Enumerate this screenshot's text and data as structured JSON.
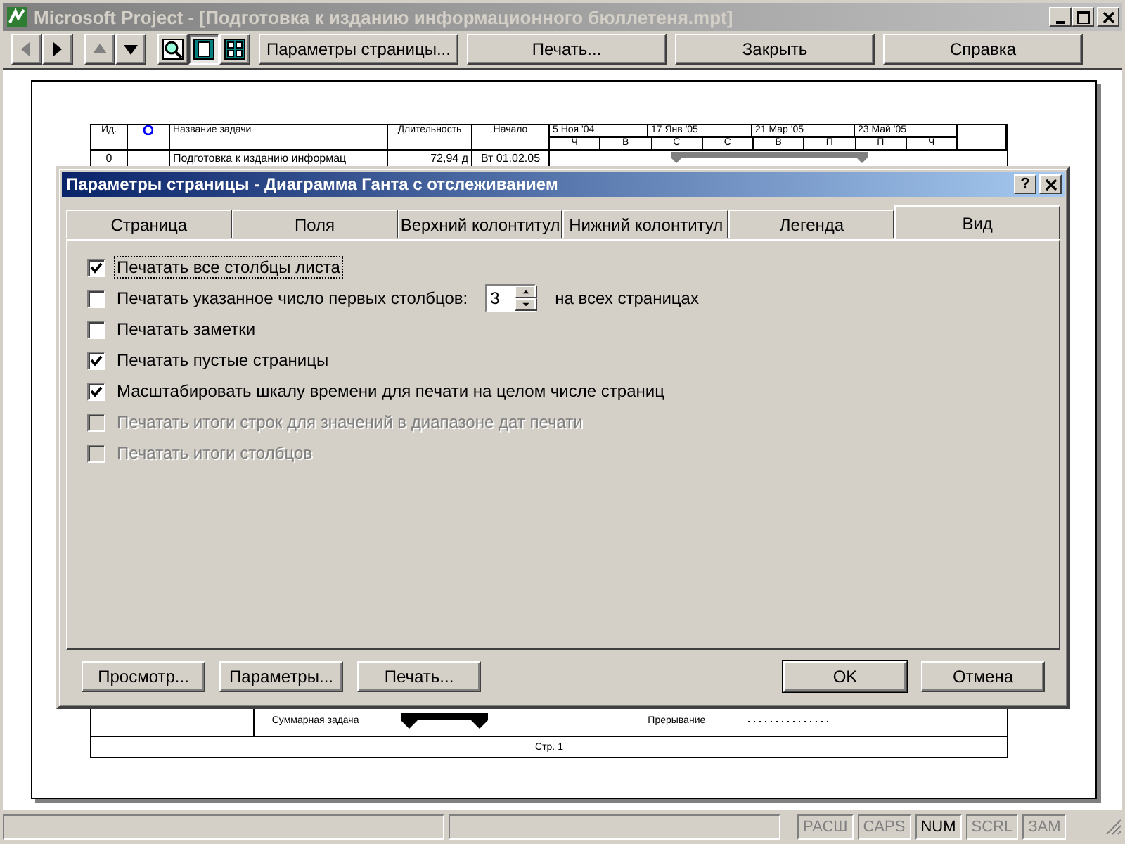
{
  "window": {
    "title": "Microsoft Project - [Подготовка к изданию информационного бюллетеня.mpt]"
  },
  "toolbar": {
    "nav_buttons": [
      {
        "kind": "left",
        "disabled": true
      },
      {
        "kind": "right",
        "disabled": false
      },
      {
        "kind": "up",
        "disabled": true
      },
      {
        "kind": "down",
        "disabled": false
      }
    ],
    "view_buttons": [
      {
        "kind": "zoom",
        "selected": false
      },
      {
        "kind": "one-page",
        "selected": true
      },
      {
        "kind": "multi-page",
        "selected": false
      }
    ],
    "buttons": [
      "Параметры страницы...",
      "Печать...",
      "Закрыть",
      "Справка"
    ]
  },
  "preview": {
    "table": {
      "columns": [
        "Ид.",
        "Название задачи",
        "Длительность",
        "Начало"
      ],
      "timescale": [
        {
          "label": "5 Ноя '04",
          "days": [
            "Ч",
            "В"
          ]
        },
        {
          "label": "17 Янв '05",
          "days": [
            "С",
            "С"
          ]
        },
        {
          "label": "21 Мар '05",
          "days": [
            "В",
            "П"
          ]
        },
        {
          "label": "23 Май '05",
          "days": [
            "П",
            "Ч"
          ]
        }
      ],
      "rows": [
        {
          "id": "0",
          "name": "Подготовка к изданию информац",
          "duration": "72,94 д",
          "start": "Вт 01.02.05"
        }
      ]
    },
    "legend": [
      {
        "kind": "summary",
        "label": "Суммарная задача"
      },
      {
        "kind": "split",
        "label": "Прерывание"
      }
    ],
    "footer": "Стр. 1"
  },
  "dialog": {
    "title": "Параметры страницы - Диаграмма Ганта с отслеживанием",
    "help_button": "?",
    "tabs": [
      {
        "label": "Страница",
        "selected": false
      },
      {
        "label": "Поля",
        "selected": false
      },
      {
        "label": "Верхний колонтитул",
        "selected": false
      },
      {
        "label": "Нижний колонтитул",
        "selected": false
      },
      {
        "label": "Легенда",
        "selected": false
      },
      {
        "label": "Вид",
        "selected": true
      }
    ],
    "options": [
      {
        "kind": "check",
        "label": "Печатать все столбцы листа",
        "checked": true,
        "disabled": false,
        "focused": true
      },
      {
        "kind": "spin",
        "label": "Печатать указанное число первых столбцов:",
        "value": "3",
        "suffix": "на всех страницах",
        "checked": false,
        "disabled": false,
        "focused": false
      },
      {
        "kind": "check",
        "label": "Печатать заметки",
        "checked": false,
        "disabled": false,
        "focused": false
      },
      {
        "kind": "check",
        "label": "Печатать пустые страницы",
        "checked": true,
        "disabled": false,
        "focused": false
      },
      {
        "kind": "check",
        "label": "Масштабировать шкалу времени для печати на целом числе страниц",
        "checked": true,
        "disabled": false,
        "focused": false
      },
      {
        "kind": "check",
        "label": "Печатать итоги строк для значений в диапазоне дат печати",
        "checked": false,
        "disabled": true,
        "focused": false
      },
      {
        "kind": "check",
        "label": "Печатать итоги столбцов",
        "checked": false,
        "disabled": true,
        "focused": false
      }
    ],
    "buttons_left": [
      "Просмотр...",
      "Параметры...",
      "Печать..."
    ],
    "buttons_right": [
      {
        "label": "OK",
        "default": true
      },
      {
        "label": "Отмена",
        "default": false
      }
    ]
  },
  "status_bar": {
    "indicators": [
      {
        "label": "РАСШ",
        "on": false
      },
      {
        "label": "CAPS",
        "on": false
      },
      {
        "label": "NUM",
        "on": true
      },
      {
        "label": "SCRL",
        "on": false
      },
      {
        "label": "ЗАМ",
        "on": false
      }
    ]
  }
}
